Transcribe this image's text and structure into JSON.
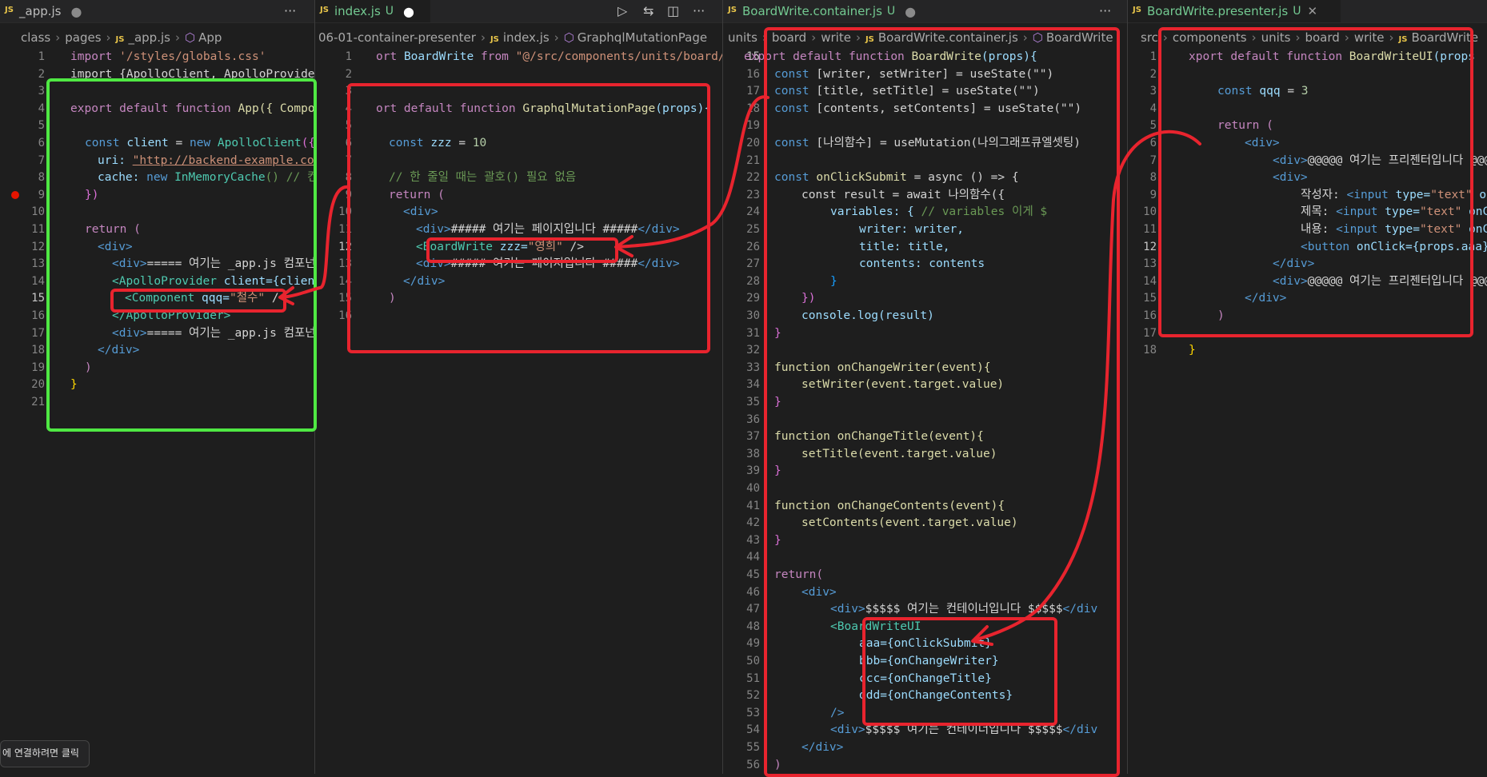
{
  "colors": {
    "accent_red": "#e8242e",
    "accent_green": "#4fe843",
    "editor_bg": "#1e1e1e"
  },
  "panes": [
    {
      "tab": {
        "badge": "JS",
        "name": "_app.js",
        "modified_dot": "●",
        "more": "···"
      },
      "breadcrumb": [
        "class",
        "pages",
        "_app.js",
        "App"
      ],
      "lines": [
        {
          "n": "1"
        },
        {
          "n": "2"
        },
        {
          "n": "3"
        },
        {
          "n": "4"
        },
        {
          "n": "5"
        },
        {
          "n": "6"
        },
        {
          "n": "7"
        },
        {
          "n": "8"
        },
        {
          "n": "9"
        },
        {
          "n": "10"
        },
        {
          "n": "11"
        },
        {
          "n": "12"
        },
        {
          "n": "13"
        },
        {
          "n": "14"
        },
        {
          "n": "15"
        },
        {
          "n": "16"
        },
        {
          "n": "17"
        },
        {
          "n": "18"
        },
        {
          "n": "19"
        },
        {
          "n": "20"
        },
        {
          "n": "21"
        }
      ],
      "code": {
        "l1_import": "import",
        "l1_path": "'/styles/globals.css'",
        "l2": "import {ApolloClient, ApolloProvide",
        "l4_export": "export default function",
        "l4_fn": "App",
        "l4_rest": "({ Compo",
        "l6_const": "const",
        "l6_client": "client",
        "l6_new": "new",
        "l6_cls": "ApolloClient",
        "l6_rest": "({",
        "l7_uri": "uri:",
        "l7_val": "\"http://backend-example.co",
        "l8_cache": "cache:",
        "l8_new": "new",
        "l8_cls": "InMemoryCache",
        "l8_rest": "() // 컨",
        "l9": "})",
        "l11": "return (",
        "l12": "<div>",
        "l13_open": "<div>",
        "l13_text": "===== 여기는 _app.js 컴포넌트",
        "l14_tag": "<ApolloProvider",
        "l14_attr": "client={clien",
        "l15_tag": "<Component",
        "l15_attr": "qqq=",
        "l15_val": "\"철수\"",
        "l15_end": " /",
        "l16": "</ApolloProvider>",
        "l17_open": "<div>",
        "l17_text": "===== 여기는 _app.js 컴포넌트",
        "l18": "</div>",
        "l19": ")",
        "l20": "}"
      },
      "status_tooltip": "에 연결하려면 클릭"
    },
    {
      "tab": {
        "badge": "JS",
        "name": "index.js",
        "u_flag": "U",
        "modified_dot": "●",
        "run": "▷",
        "compare": "⇆",
        "split": "◫",
        "more": "···"
      },
      "breadcrumb": [
        "06-01-container-presenter",
        "index.js",
        "GraphqlMutationPage"
      ],
      "lines": [
        {
          "n": "1"
        },
        {
          "n": "2"
        },
        {
          "n": "3"
        },
        {
          "n": "4"
        },
        {
          "n": "5"
        },
        {
          "n": "6"
        },
        {
          "n": "7"
        },
        {
          "n": "8"
        },
        {
          "n": "9"
        },
        {
          "n": "10"
        },
        {
          "n": "11"
        },
        {
          "n": "12"
        },
        {
          "n": "13"
        },
        {
          "n": "14"
        },
        {
          "n": "15"
        },
        {
          "n": "16"
        }
      ],
      "code": {
        "l1_kw": "ort",
        "l1_cls": "BoardWrite",
        "l1_from": "from",
        "l1_str": "\"@/src/components/units/board/w",
        "l4_kw": "ort default function",
        "l4_fn": "GraphqlMutationPage",
        "l4_rest": "(props){",
        "l6_const": "const",
        "l6_var": "zzz",
        "l6_eq": "=",
        "l6_num": "10",
        "l8_cmt": "// 한 줄일 때는 괄호() 필요 없음",
        "l9": "return (",
        "l10": "<div>",
        "l11_open": "<div>",
        "l11_text": "##### 여기는 페이지입니다 #####",
        "l11_close": "</div>",
        "l12_tag": "<BoardWrite",
        "l12_attr": "zzz=",
        "l12_val": "\"영희\"",
        "l12_end": " />",
        "l13_open": "<div>",
        "l13_text": "##### 여기는 페이지입니다 #####",
        "l13_close": "</div>",
        "l14": "</div>",
        "l15": ")"
      }
    },
    {
      "tab": {
        "badge": "JS",
        "name": "BoardWrite.container.js",
        "u_flag": "U",
        "modified_dot": "●",
        "more": "···"
      },
      "breadcrumb": [
        "units",
        "board",
        "write",
        "BoardWrite.container.js",
        "BoardWrite"
      ],
      "lines": [
        {
          "n": "15"
        },
        {
          "n": "16"
        },
        {
          "n": "17"
        },
        {
          "n": "18"
        },
        {
          "n": "19"
        },
        {
          "n": "20"
        },
        {
          "n": "21"
        },
        {
          "n": "22"
        },
        {
          "n": "23"
        },
        {
          "n": "24"
        },
        {
          "n": "25"
        },
        {
          "n": "26"
        },
        {
          "n": "27"
        },
        {
          "n": "28"
        },
        {
          "n": "29"
        },
        {
          "n": "30"
        },
        {
          "n": "31"
        },
        {
          "n": "32"
        },
        {
          "n": "33"
        },
        {
          "n": "34"
        },
        {
          "n": "35"
        },
        {
          "n": "36"
        },
        {
          "n": "37"
        },
        {
          "n": "38"
        },
        {
          "n": "39"
        },
        {
          "n": "40"
        },
        {
          "n": "41"
        },
        {
          "n": "42"
        },
        {
          "n": "43"
        },
        {
          "n": "44"
        },
        {
          "n": "45"
        },
        {
          "n": "46"
        },
        {
          "n": "47"
        },
        {
          "n": "48"
        },
        {
          "n": "49"
        },
        {
          "n": "50"
        },
        {
          "n": "51"
        },
        {
          "n": "52"
        },
        {
          "n": "53"
        },
        {
          "n": "54"
        },
        {
          "n": "55"
        },
        {
          "n": "56"
        }
      ],
      "code": {
        "l15": "export default function",
        "l15_fn": "BoardWrite",
        "l15_rest": "(props){",
        "l16": "[writer, setWriter] = useState(\"\")",
        "l17": "[title, setTitle] = useState(\"\")",
        "l18": "[contents, setContents] = useState(\"\")",
        "l20": "[나의함수] = useMutation(나의그래프큐엘셋팅)",
        "l22_fn": "onClickSubmit",
        "l22_rest": "= async () => {",
        "l23": "const result = await 나의함수({",
        "l24": "variables: {",
        "l24_cmt": "// variables 이게 $",
        "l25": "writer: writer,",
        "l26": "title: title,",
        "l27": "contents: contents",
        "l28": "}",
        "l29": "})",
        "l30": "console.log(result)",
        "l31": "}",
        "l33": "function onChangeWriter(event){",
        "l34": "setWriter(event.target.value)",
        "l35": "}",
        "l37": "function onChangeTitle(event){",
        "l38": "setTitle(event.target.value)",
        "l39": "}",
        "l41": "function onChangeContents(event){",
        "l42": "setContents(event.target.value)",
        "l43": "}",
        "l45": "return(",
        "l46": "<div>",
        "l47_open": "<div>",
        "l47_text": "$$$$$ 여기는 컨테이너입니다 $$$$$",
        "l47_close": "</div",
        "l48": "<BoardWriteUI",
        "l49": "aaa={onClickSubmit}",
        "l50": "bbb={onChangeWriter}",
        "l51": "ccc={onChangeTitle}",
        "l52": "ddd={onChangeContents}",
        "l53": "/>",
        "l54_open": "<div>",
        "l54_text": "$$$$$ 여기는 컨테이너입니다 $$$$$",
        "l54_close": "</div",
        "l55": "</div>",
        "l56": ")"
      }
    },
    {
      "tab": {
        "badge": "JS",
        "name": "BoardWrite.presenter.js",
        "u_flag": "U",
        "close": "✕"
      },
      "breadcrumb": [
        "src",
        "components",
        "units",
        "board",
        "write",
        "BoardWrite"
      ],
      "lines": [
        {
          "n": "1"
        },
        {
          "n": "2"
        },
        {
          "n": "3"
        },
        {
          "n": "4"
        },
        {
          "n": "5"
        },
        {
          "n": "6"
        },
        {
          "n": "7"
        },
        {
          "n": "8"
        },
        {
          "n": "9"
        },
        {
          "n": "10"
        },
        {
          "n": "11"
        },
        {
          "n": "12"
        },
        {
          "n": "13"
        },
        {
          "n": "14"
        },
        {
          "n": "15"
        },
        {
          "n": "16"
        },
        {
          "n": "17"
        },
        {
          "n": "18"
        }
      ],
      "code": {
        "l1": "xport default function",
        "l1_fn": "BoardWriteUI",
        "l1_rest": "(props",
        "l3_const": "const",
        "l3_var": "qqq",
        "l3_eq": "=",
        "l3_num": "3",
        "l5": "return (",
        "l6": "<div>",
        "l7_open": "<div>",
        "l7_text": "@@@@@ 여기는 프리젠터입니다 @@@@",
        "l8": "<div>",
        "l9_label": "작성자:",
        "l9_tag": "<input",
        "l9_attr": "type=",
        "l9_val": "\"text\"",
        "l9_more": "or",
        "l10_label": "제목:",
        "l10_tag": "<input",
        "l10_attr": "type=",
        "l10_val": "\"text\"",
        "l10_more": "onC",
        "l11_label": "내용:",
        "l11_tag": "<input",
        "l11_attr": "type=",
        "l11_val": "\"text\"",
        "l11_more": "onC",
        "l12_tag": "<button",
        "l12_attr": "onClick=",
        "l12_val": "{props.aaa}",
        "l13": "</div>",
        "l14_open": "<div>",
        "l14_text": "@@@@@ 여기는 프리젠터입니다 @@@@",
        "l15": "</div>",
        "l16": ")",
        "l18": "}"
      }
    }
  ]
}
